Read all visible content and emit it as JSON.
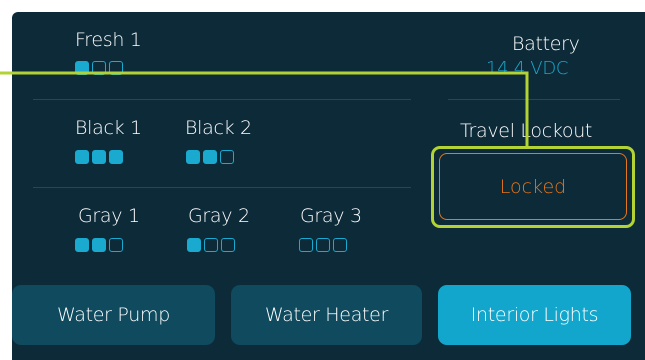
{
  "colors": {
    "background": "#0d2a38",
    "accent": "#1aa9cf",
    "button": "#0f4a5e",
    "button_active": "#12a6cc",
    "locked": "#e8761b",
    "highlight": "#b3d334"
  },
  "tanks": {
    "fresh": [
      {
        "label": "Fresh 1",
        "level": 1,
        "segments": 3
      }
    ],
    "black": [
      {
        "label": "Black 1",
        "level": 3,
        "segments": 3
      },
      {
        "label": "Black 2",
        "level": 2,
        "segments": 3
      }
    ],
    "gray": [
      {
        "label": "Gray 1",
        "level": 2,
        "segments": 3
      },
      {
        "label": "Gray 2",
        "level": 1,
        "segments": 3
      },
      {
        "label": "Gray 3",
        "level": 0,
        "segments": 3
      }
    ]
  },
  "battery": {
    "label": "Battery",
    "value": "14.4 VDC"
  },
  "travel_lockout": {
    "label": "Travel Lockout",
    "state": "Locked"
  },
  "buttons": {
    "water_pump": "Water Pump",
    "water_heater": "Water Heater",
    "interior_lights": "Interior Lights",
    "active": "interior_lights"
  }
}
